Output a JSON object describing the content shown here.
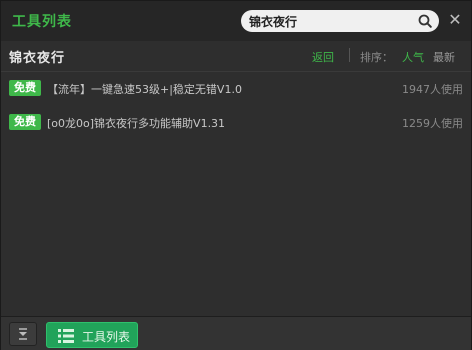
{
  "app": {
    "title": "工具列表"
  },
  "search": {
    "value": "锦衣夜行",
    "placeholder": ""
  },
  "header": {
    "title": "锦衣夜行",
    "back_label": "返回",
    "sort_label": "排序：",
    "sort_options": [
      "人气",
      "最新"
    ],
    "active_sort": "人气"
  },
  "results": [
    {
      "badge": "免费",
      "title": "【流年】一键急速53级+|稳定无错V1.0",
      "users": "1947人使用"
    },
    {
      "badge": "免费",
      "title": "[o0龙0o]锦衣夜行多功能辅助V1.31",
      "users": "1259人使用"
    }
  ],
  "bottom": {
    "toolbox_label": "工具列表"
  },
  "colors": {
    "accent": "#3fb84a",
    "background": "#2e2e2e",
    "button_green": "#21a35a"
  },
  "icons": [
    "search-icon",
    "close-icon",
    "collapse-icon",
    "list-icon"
  ]
}
